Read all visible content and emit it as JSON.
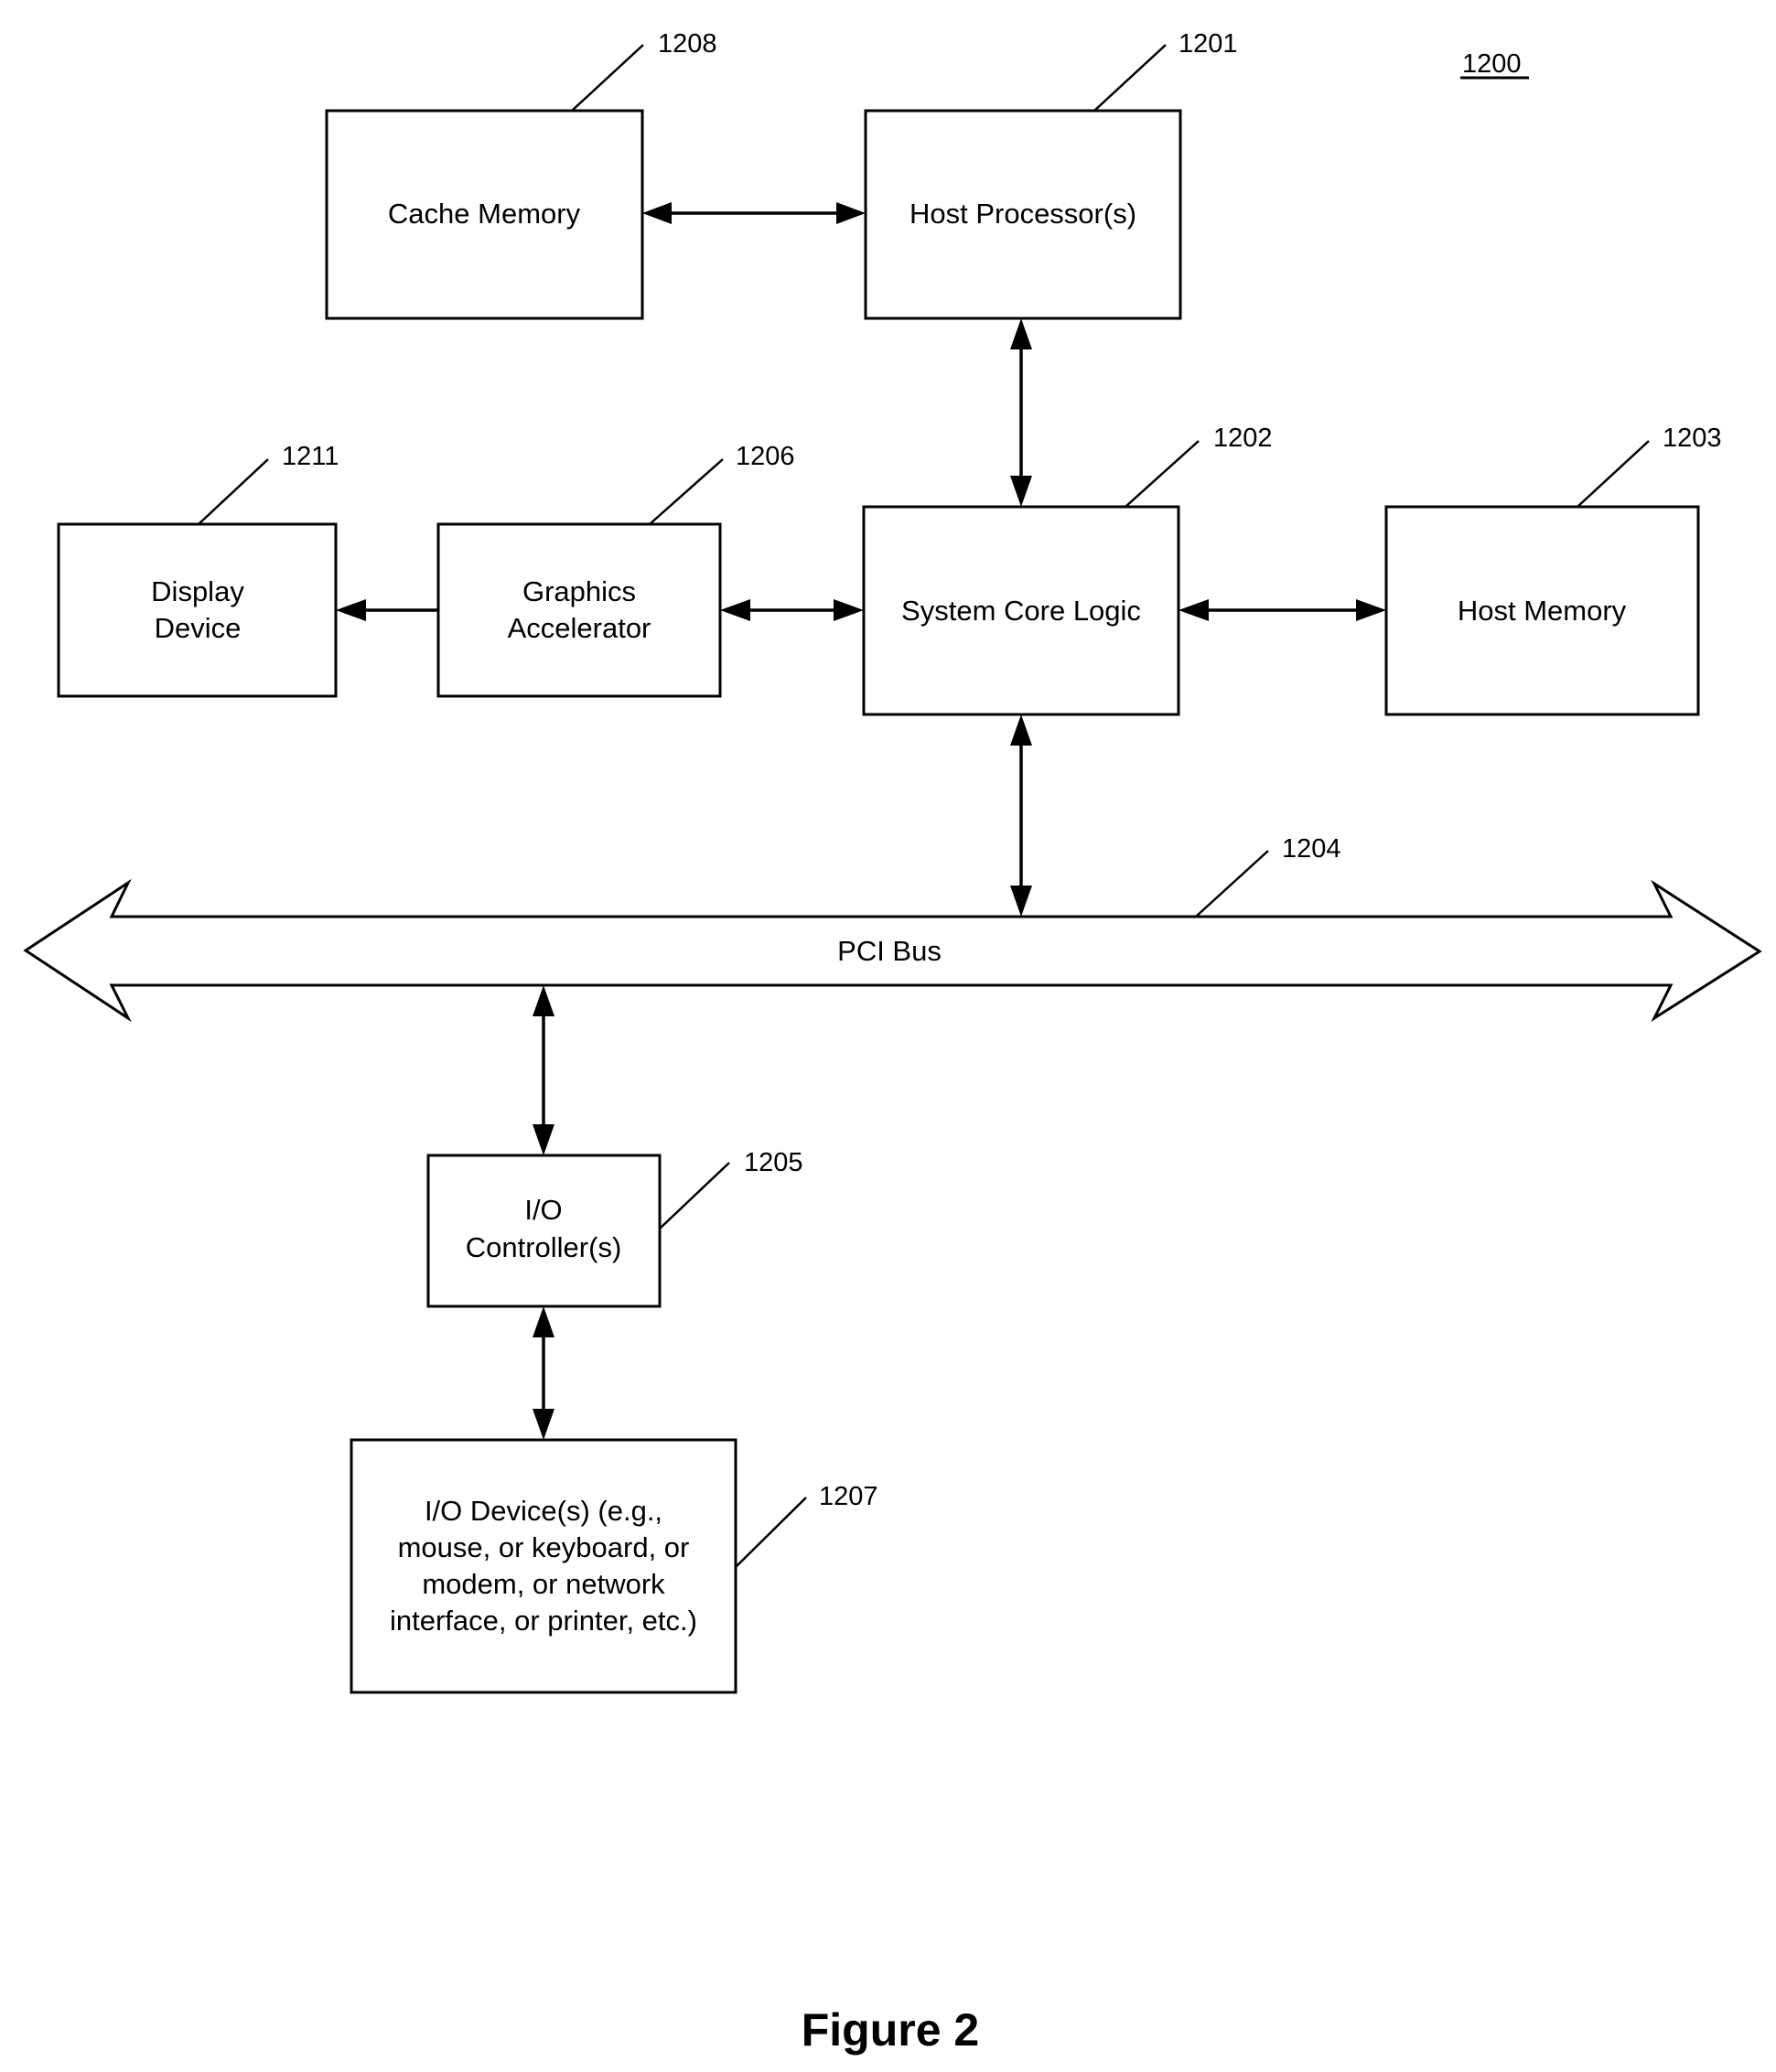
{
  "figure": {
    "number": "1200",
    "caption": "Figure 2"
  },
  "blocks": {
    "cache_memory": {
      "ref": "1208",
      "lines": [
        "Cache Memory"
      ]
    },
    "host_processor": {
      "ref": "1201",
      "lines": [
        "Host Processor(s)"
      ]
    },
    "display_device": {
      "ref": "1211",
      "lines": [
        "Display",
        "Device"
      ]
    },
    "graphics_accelerator": {
      "ref": "1206",
      "lines": [
        "Graphics",
        "Accelerator"
      ]
    },
    "system_core_logic": {
      "ref": "1202",
      "lines": [
        "System Core Logic"
      ]
    },
    "host_memory": {
      "ref": "1203",
      "lines": [
        "Host Memory"
      ]
    },
    "pci_bus": {
      "ref": "1204",
      "lines": [
        "PCI Bus"
      ]
    },
    "io_controller": {
      "ref": "1205",
      "lines": [
        "I/O",
        "Controller(s)"
      ]
    },
    "io_device": {
      "ref": "1207",
      "lines": [
        "I/O Device(s) (e.g.,",
        "mouse, or keyboard, or",
        "modem, or network",
        "interface, or printer, etc.)"
      ]
    }
  },
  "connections": [
    {
      "from": "cache_memory",
      "to": "host_processor",
      "direction": "bidirectional"
    },
    {
      "from": "host_processor",
      "to": "system_core_logic",
      "direction": "bidirectional"
    },
    {
      "from": "graphics_accelerator",
      "to": "display_device",
      "direction": "unidirectional"
    },
    {
      "from": "graphics_accelerator",
      "to": "system_core_logic",
      "direction": "bidirectional"
    },
    {
      "from": "system_core_logic",
      "to": "host_memory",
      "direction": "bidirectional"
    },
    {
      "from": "system_core_logic",
      "to": "pci_bus",
      "direction": "bidirectional"
    },
    {
      "from": "pci_bus",
      "to": "io_controller",
      "direction": "bidirectional"
    },
    {
      "from": "io_controller",
      "to": "io_device",
      "direction": "bidirectional"
    }
  ]
}
